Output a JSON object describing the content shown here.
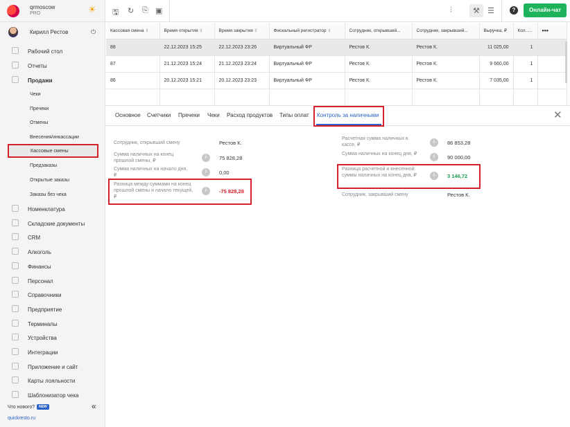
{
  "brand": {
    "name": "qrmoscow",
    "plan": "PRO",
    "theme_icon": "sun-icon"
  },
  "user": {
    "name": "Кирилл Рестов",
    "power_icon": "power-icon"
  },
  "nav": [
    {
      "label": "Рабочий стол",
      "icon": "dashboard-icon"
    },
    {
      "label": "Отчеты",
      "icon": "reports-icon"
    },
    {
      "label": "Продажи",
      "icon": "sales-icon"
    }
  ],
  "sales_sub": [
    "Чеки",
    "Пречеки",
    "Отмены",
    "Внесения/инкассации",
    "Кассовые смены",
    "Предзаказы",
    "Открытые заказы",
    "Заказы без чека"
  ],
  "nav2": [
    {
      "label": "Номенклатура",
      "icon": "nomenclature-icon"
    },
    {
      "label": "Складские документы",
      "icon": "warehouse-icon"
    },
    {
      "label": "CRM",
      "icon": "crm-icon"
    },
    {
      "label": "Алкоголь",
      "icon": "alcohol-icon"
    },
    {
      "label": "Финансы",
      "icon": "finance-icon"
    },
    {
      "label": "Персонал",
      "icon": "staff-icon"
    },
    {
      "label": "Справочники",
      "icon": "reference-icon"
    },
    {
      "label": "Предприятие",
      "icon": "enterprise-icon"
    },
    {
      "label": "Терминалы",
      "icon": "terminals-icon"
    },
    {
      "label": "Устройства",
      "icon": "devices-icon"
    },
    {
      "label": "Интеграции",
      "icon": "integrations-icon"
    },
    {
      "label": "Приложение и сайт",
      "icon": "app-site-icon"
    },
    {
      "label": "Карты лояльности",
      "icon": "loyalty-icon"
    },
    {
      "label": "Шаблонизатор чека",
      "icon": "receipt-template-icon"
    }
  ],
  "footer": {
    "whats_new": "Что нового?",
    "badge": "NEW",
    "collapse": "«",
    "site": "quickresto.ru"
  },
  "toolbar": {
    "chat": "Онлайн-чат",
    "help": "?"
  },
  "table": {
    "headers": [
      "Кассовая смена",
      "Время открытия",
      "Время закрытия",
      "Фискальный регистратор",
      "Сотрудник, открывший...",
      "Сотрудник, закрывший...",
      "Выручка, ₽",
      "Кол...",
      "•••"
    ],
    "rows": [
      [
        "88",
        "22.12.2023 15:25",
        "22.12.2023 23:26",
        "Виртуальный ФР",
        "Рестов К.",
        "Рестов К.",
        "11 025,00",
        "1"
      ],
      [
        "87",
        "21.12.2023 15:24",
        "21.12.2023 23:24",
        "Виртуальный ФР",
        "Рестов К.",
        "Рестов К.",
        "9 660,00",
        "1"
      ],
      [
        "86",
        "20.12.2023 15:21",
        "20.12.2023 23:23",
        "Виртуальный ФР",
        "Рестов К.",
        "Рестов К.",
        "7 035,00",
        "1"
      ]
    ]
  },
  "tabs": [
    "Основное",
    "Счетчики",
    "Пречеки",
    "Чеки",
    "Расход продуктов",
    "Типы оплат",
    "Контроль за наличными"
  ],
  "details": {
    "left": [
      {
        "label": "Сотрудник, открывший смену",
        "value": "Рестов К."
      },
      {
        "label": "Сумма наличных на конец прошлой смены, ₽",
        "value": "75 828,28"
      },
      {
        "label": "Сумма наличных на начало дня, ₽",
        "value": "0,00"
      },
      {
        "label": "Разница между суммами на конец прошлой смены и начало текущей, ₽",
        "value": "-75 828,28"
      }
    ],
    "right": [
      {
        "label": "Расчетная сумма наличных в кассе, ₽",
        "value": "86 853,28"
      },
      {
        "label": "Сумма наличных на конец дня, ₽",
        "value": "90 000,00"
      },
      {
        "label": "Разница расчетной и внесенной суммы наличных на конец дня, ₽",
        "value": "3 146,72"
      },
      {
        "label": "Сотрудник, закрывший смену",
        "value": "Рестов К."
      }
    ]
  },
  "colors": {
    "accent": "#2a62c9",
    "highlight": "#d4202a",
    "success": "#1db35a"
  }
}
